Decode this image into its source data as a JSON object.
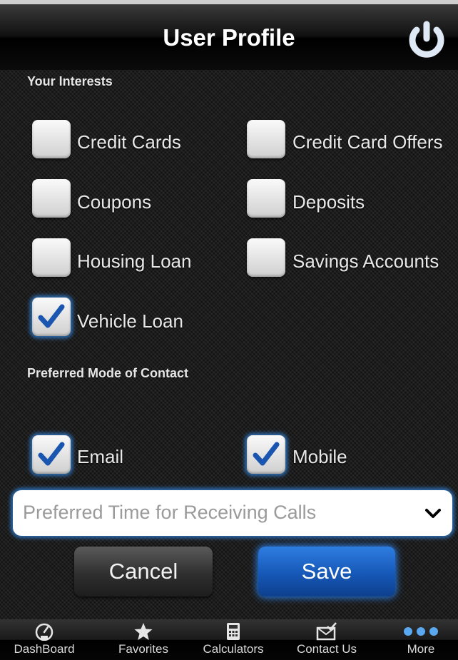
{
  "header": {
    "title": "User Profile",
    "power_icon": "power-icon"
  },
  "interests": {
    "heading": "Your Interests",
    "items": [
      {
        "label": "Credit Cards",
        "checked": false
      },
      {
        "label": "Credit Card Offers",
        "checked": false
      },
      {
        "label": "Coupons",
        "checked": false
      },
      {
        "label": "Deposits",
        "checked": false
      },
      {
        "label": "Housing Loan",
        "checked": false
      },
      {
        "label": "Savings Accounts",
        "checked": false
      },
      {
        "label": "Vehicle Loan",
        "checked": true
      }
    ]
  },
  "contact": {
    "heading": "Preferred Mode of Contact",
    "items": [
      {
        "label": "Email",
        "checked": true
      },
      {
        "label": "Mobile",
        "checked": true
      }
    ]
  },
  "call_time": {
    "placeholder": "Preferred Time for Receiving Calls"
  },
  "actions": {
    "cancel_label": "Cancel",
    "save_label": "Save"
  },
  "tabbar": {
    "items": [
      {
        "label": "DashBoard",
        "icon": "speedometer-icon"
      },
      {
        "label": "Favorites",
        "icon": "star-icon"
      },
      {
        "label": "Calculators",
        "icon": "calculator-icon"
      },
      {
        "label": "Contact Us",
        "icon": "envelope-check-icon"
      },
      {
        "label": "More",
        "icon": "more-dots-icon"
      }
    ]
  },
  "colors": {
    "accent": "#2d6fb5",
    "check": "#1a56b0",
    "save": "#1658b7"
  }
}
